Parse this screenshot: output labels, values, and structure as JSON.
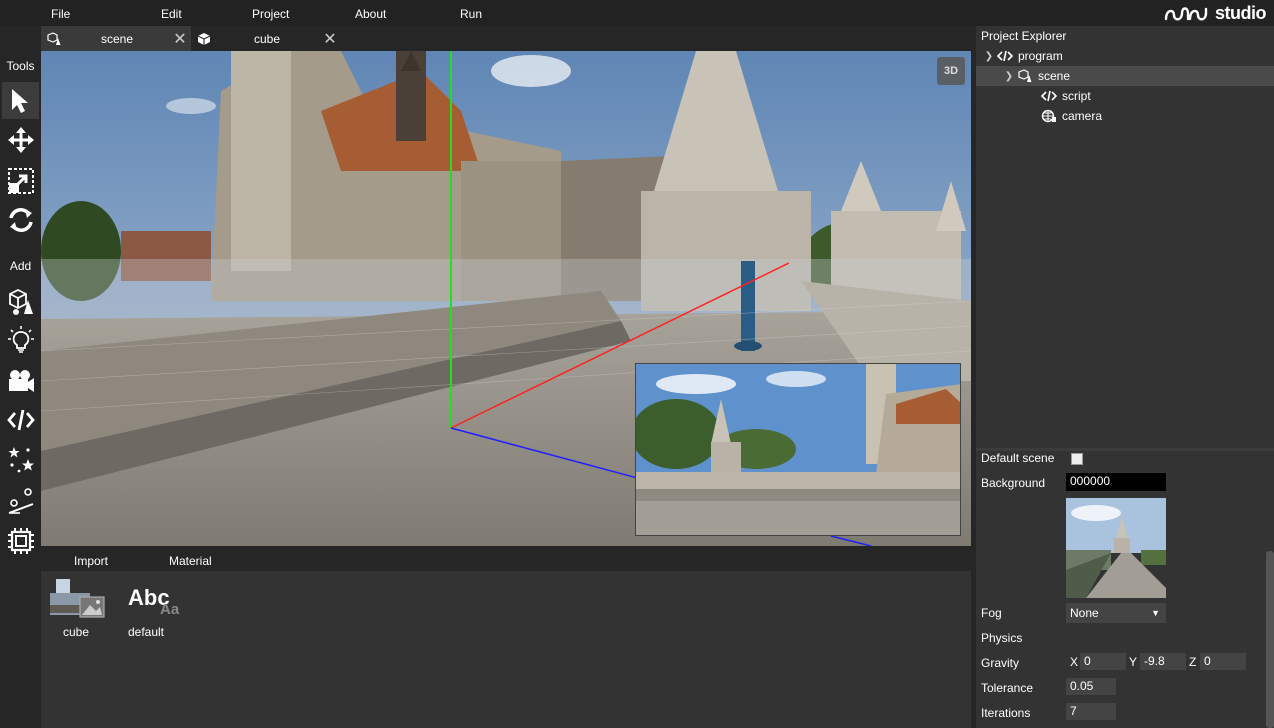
{
  "menu": {
    "file": "File",
    "edit": "Edit",
    "project": "Project",
    "about": "About",
    "run": "Run"
  },
  "logo": {
    "text": "studio"
  },
  "toolbar": {
    "tools_label": "Tools",
    "add_label": "Add",
    "tools": [
      "select-icon",
      "move-icon",
      "scale-icon",
      "rotate-icon"
    ],
    "add": [
      "model-icon",
      "light-icon",
      "camera-icon",
      "script-icon",
      "particles-icon",
      "physics-icon",
      "chip-icon"
    ]
  },
  "tabs": [
    {
      "label": "scene",
      "icon": "scene-icon"
    },
    {
      "label": "cube",
      "icon": "cube-icon"
    }
  ],
  "viewport": {
    "mode_button": "3D"
  },
  "assets": {
    "tabs": [
      "Import",
      "Material"
    ],
    "items": [
      {
        "label": "cube"
      },
      {
        "label": "default",
        "thumb_text": "Abc",
        "thumb_sub": "Aa"
      }
    ]
  },
  "explorer": {
    "title": "Project Explorer",
    "items": [
      {
        "label": "program",
        "icon": "code-icon"
      },
      {
        "label": "scene",
        "icon": "scene-icon"
      },
      {
        "label": "script",
        "icon": "code-icon"
      },
      {
        "label": "camera",
        "icon": "camera-globe-icon"
      }
    ]
  },
  "inspector": {
    "default_scene": "Default scene",
    "background_label": "Background",
    "background_value": "000000",
    "fog_label": "Fog",
    "fog_value": "None",
    "physics_label": "Physics",
    "gravity_label": "Gravity",
    "gravity": {
      "x_label": "X",
      "x": "0",
      "y_label": "Y",
      "y": "-9.8",
      "z_label": "Z",
      "z": "0"
    },
    "tolerance_label": "Tolerance",
    "tolerance_value": "0.05",
    "iterations_label": "Iterations",
    "iterations_value": "7"
  },
  "colors": {
    "background": "#262626",
    "panel": "#333333",
    "axis_x": "#ff2020",
    "axis_y": "#20e020",
    "axis_z": "#2020ff"
  }
}
